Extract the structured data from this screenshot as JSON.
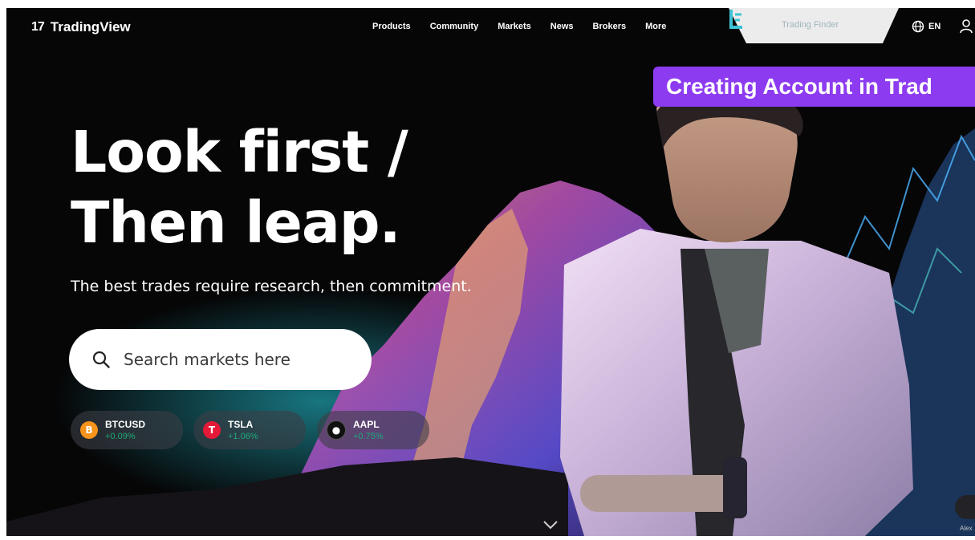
{
  "header": {
    "brand": "TradingView",
    "brand_mark": "17",
    "nav": [
      "Products",
      "Community",
      "Markets",
      "News",
      "Brokers",
      "More"
    ],
    "finder_label": "Trading Finder",
    "language": "EN"
  },
  "banner": {
    "text": "Creating Account in Trad"
  },
  "hero": {
    "line1": "Look first /",
    "line2": "Then leap.",
    "subtitle": "The best trades require research, then commitment."
  },
  "search": {
    "placeholder": "Search markets here"
  },
  "tickers": [
    {
      "symbol": "BTCUSD",
      "change": "+0.09%",
      "icon": "bitcoin-icon",
      "color": "#f7931a",
      "glyph": "B"
    },
    {
      "symbol": "TSLA",
      "change": "+1.06%",
      "icon": "tesla-icon",
      "color": "#e31937",
      "glyph": "T"
    },
    {
      "symbol": "AAPL",
      "change": "+0.75%",
      "icon": "apple-icon",
      "color": "#111111",
      "glyph": "●"
    }
  ],
  "side_label": "Alex",
  "colors": {
    "accent": "#8d3bf0",
    "positive": "#1fa87a",
    "background": "#060607"
  }
}
